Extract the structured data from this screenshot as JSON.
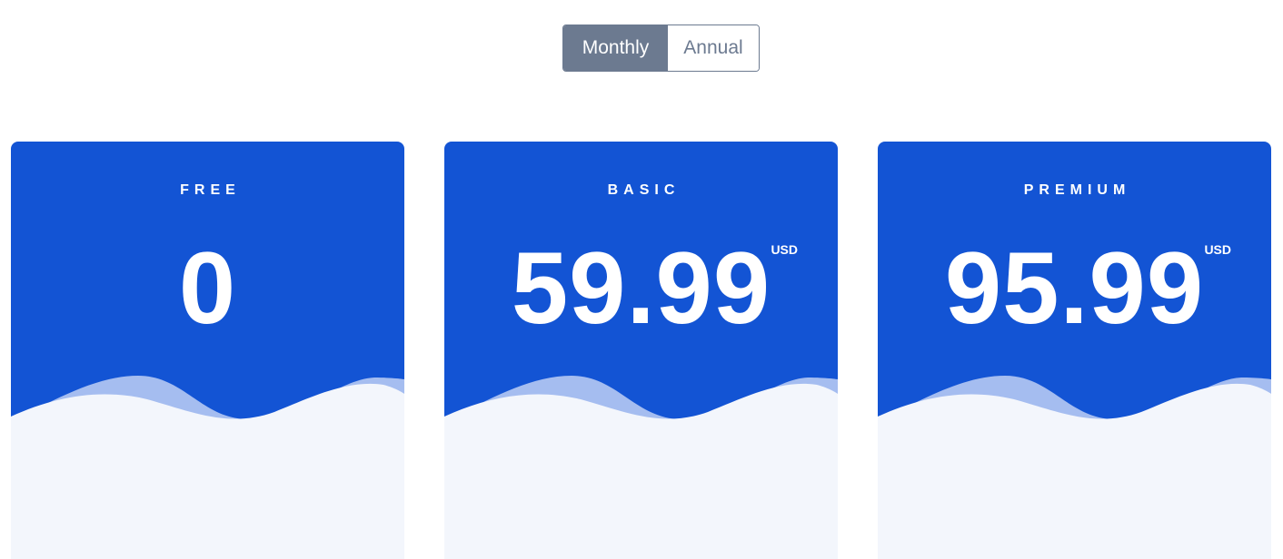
{
  "billing_toggle": {
    "monthly_label": "Monthly",
    "annual_label": "Annual",
    "selected": "Monthly"
  },
  "plans": [
    {
      "name": "FREE",
      "price": "0",
      "currency": ""
    },
    {
      "name": "BASIC",
      "price": "59.99",
      "currency": "USD"
    },
    {
      "name": "PREMIUM",
      "price": "95.99",
      "currency": "USD"
    }
  ],
  "colors": {
    "card_header": "#1354d4",
    "card_body": "#f3f6fc",
    "wave_back": "#a5bdf0",
    "toggle_active": "#6c7a90"
  }
}
